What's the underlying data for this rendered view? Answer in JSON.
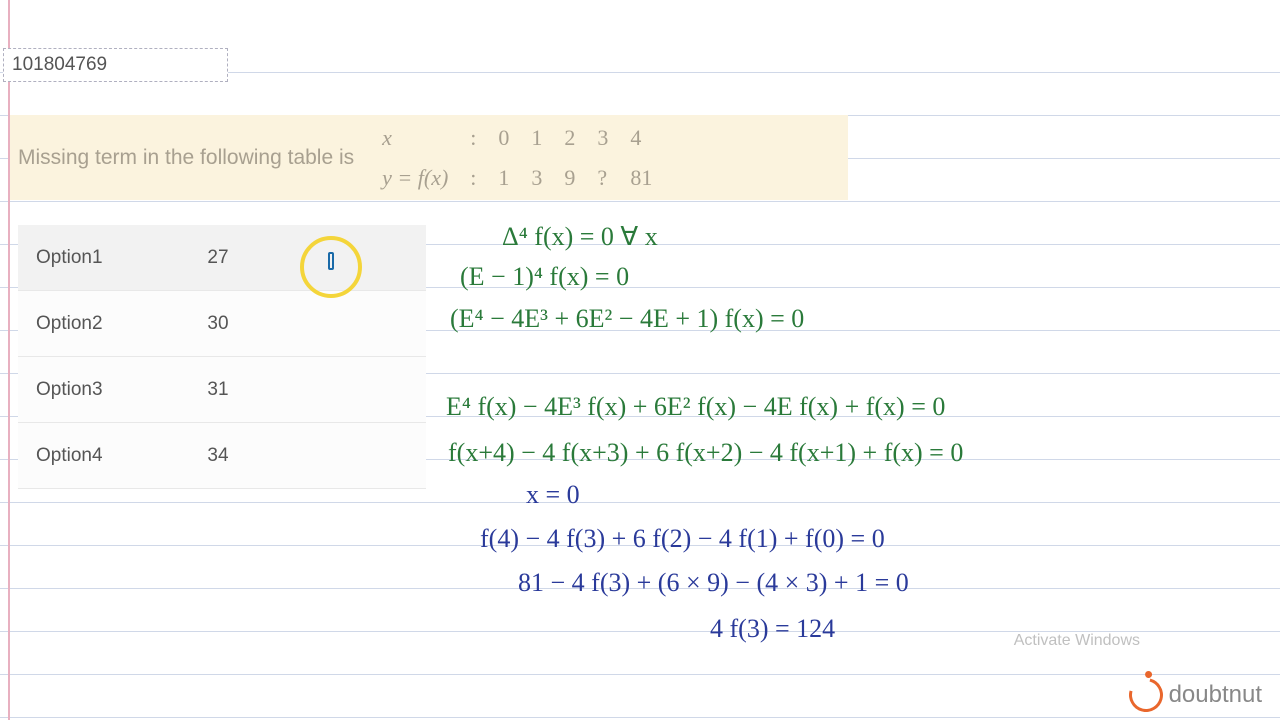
{
  "question_id": "101804769",
  "question_text": "Missing term in the following table is",
  "table": {
    "row1_label": "x",
    "row1_sep": ":",
    "row1": [
      "0",
      "1",
      "2",
      "3",
      "4"
    ],
    "row2_label": "y = f(x)",
    "row2_sep": ":",
    "row2": [
      "1",
      "3",
      "9",
      "?",
      "81"
    ]
  },
  "options": [
    {
      "label": "Option1",
      "value": "27"
    },
    {
      "label": "Option2",
      "value": "30"
    },
    {
      "label": "Option3",
      "value": "31"
    },
    {
      "label": "Option4",
      "value": "34"
    }
  ],
  "handwriting": {
    "l1": "Δ⁴ f(x) = 0   ∀ x",
    "l2": "(E − 1)⁴ f(x) = 0",
    "l3": "(E⁴ − 4E³ + 6E² − 4E + 1) f(x) = 0",
    "l4": "E⁴ f(x) − 4E³ f(x) + 6E² f(x) − 4E f(x) + f(x) = 0",
    "l5": "f(x+4) − 4 f(x+3) + 6 f(x+2) − 4 f(x+1) + f(x) = 0",
    "l6": "x = 0",
    "l7": "f(4) − 4 f(3) + 6 f(2) − 4 f(1) + f(0) = 0",
    "l8": "81 − 4 f(3) + (6 × 9) − (4 × 3) + 1 = 0",
    "l9": "4 f(3) = 124"
  },
  "watermark": "Activate Windows",
  "logo_text": "doubtnut"
}
